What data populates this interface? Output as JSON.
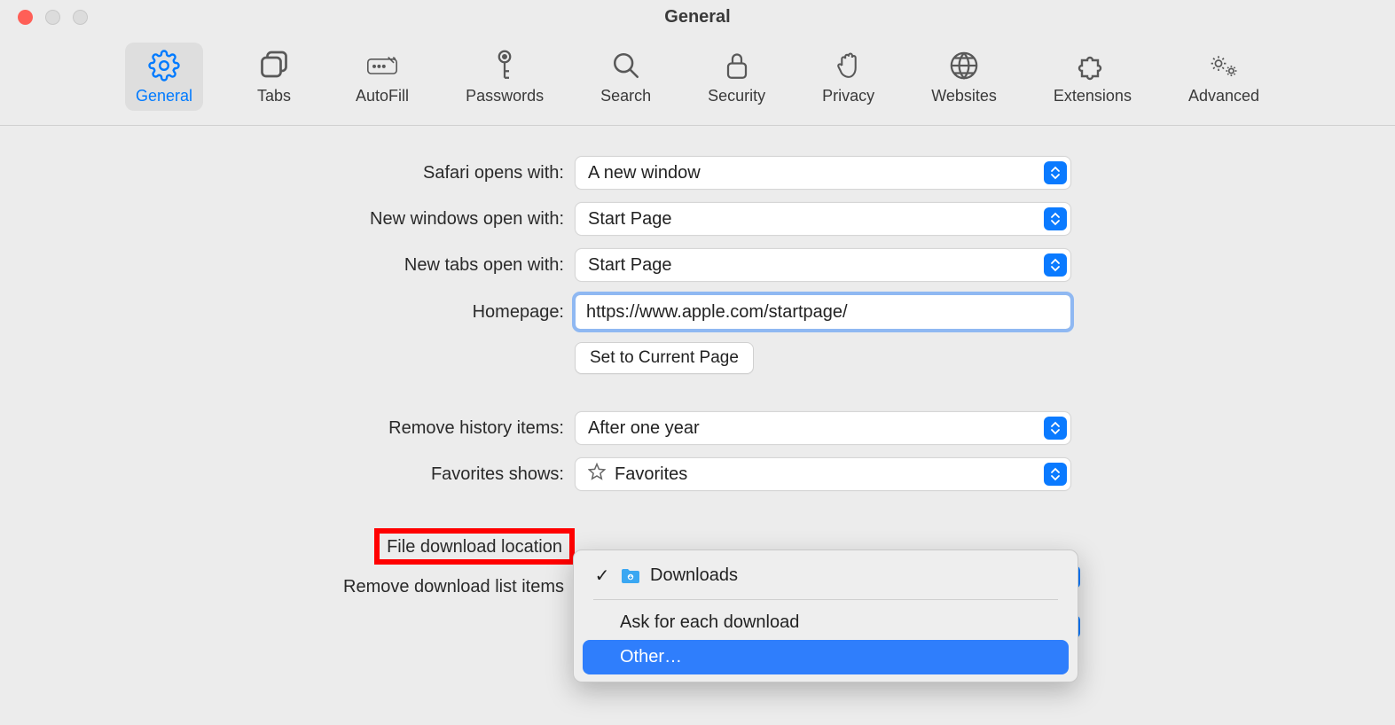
{
  "window": {
    "title": "General"
  },
  "toolbar": {
    "items": [
      {
        "label": "General"
      },
      {
        "label": "Tabs"
      },
      {
        "label": "AutoFill"
      },
      {
        "label": "Passwords"
      },
      {
        "label": "Search"
      },
      {
        "label": "Security"
      },
      {
        "label": "Privacy"
      },
      {
        "label": "Websites"
      },
      {
        "label": "Extensions"
      },
      {
        "label": "Advanced"
      }
    ]
  },
  "form": {
    "safariOpensWith": {
      "label": "Safari opens with:",
      "value": "A new window"
    },
    "newWindowsOpenWith": {
      "label": "New windows open with:",
      "value": "Start Page"
    },
    "newTabsOpenWith": {
      "label": "New tabs open with:",
      "value": "Start Page"
    },
    "homepage": {
      "label": "Homepage:",
      "value": "https://www.apple.com/startpage/"
    },
    "setToCurrent": {
      "label": "Set to Current Page"
    },
    "removeHistory": {
      "label": "Remove history items:",
      "value": "After one year"
    },
    "favoritesShows": {
      "label": "Favorites shows:",
      "value": "Favorites"
    },
    "fileDownloadLocation": {
      "label": "File download location"
    },
    "removeDownloadListItems": {
      "label": "Remove download list items"
    }
  },
  "dropdown": {
    "downloads": "Downloads",
    "ask": "Ask for each download",
    "other": "Other…"
  }
}
